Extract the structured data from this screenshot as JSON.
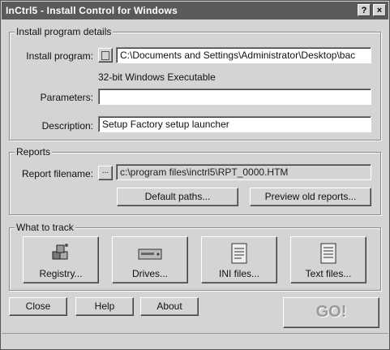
{
  "window": {
    "title": "InCtrl5 - Install Control for Windows",
    "help_glyph": "?",
    "close_glyph": "×"
  },
  "install": {
    "legend": "Install program details",
    "program_label": "Install program:",
    "program_value": "C:\\Documents and Settings\\Administrator\\Desktop\\bac",
    "type_text": "32-bit Windows Executable",
    "parameters_label": "Parameters:",
    "parameters_value": "",
    "description_label": "Description:",
    "description_value": "Setup Factory setup launcher"
  },
  "reports": {
    "legend": "Reports",
    "filename_label": "Report filename:",
    "browse_label": "...",
    "filename_value": "c:\\program files\\inctrl5\\RPT_0000.HTM",
    "default_paths": "Default paths...",
    "preview_old": "Preview old reports..."
  },
  "track": {
    "legend": "What to track",
    "registry": "Registry...",
    "drives": "Drives...",
    "ini": "INI files...",
    "text": "Text files..."
  },
  "buttons": {
    "close": "Close",
    "help": "Help",
    "about": "About",
    "go": "GO!"
  }
}
